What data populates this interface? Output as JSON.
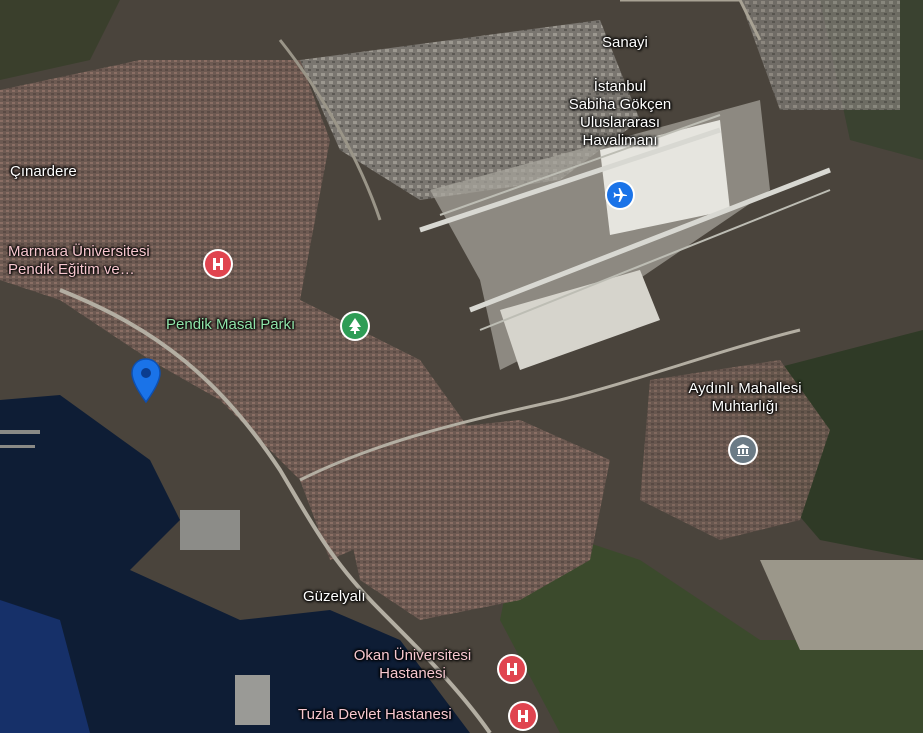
{
  "map": {
    "type": "satellite",
    "colors": {
      "sea": "#0e1d35",
      "land": "#4a443c",
      "urban": "#6a564f",
      "runway": "#cfcfc6",
      "hospital_pin": "#e0444f",
      "park_pin": "#2e9d56",
      "airport_pin": "#1a73e8",
      "office_pin": "#6b7b86",
      "location_pin": "#1a73e8"
    },
    "labels": {
      "cinardere": "Çınardere",
      "sanayi": "Sanayi",
      "airport_line1": "İstanbul",
      "airport_line2": "Sabiha Gökçen",
      "airport_line3": "Uluslararası",
      "airport_line4": "Havalimanı",
      "marmara_line1": "Marmara Üniversitesi",
      "marmara_line2": "Pendik Eğitim ve…",
      "pendik_park": "Pendik Masal Parkı",
      "aydinli_line1": "Aydınlı Mahallesi",
      "aydinli_line2": "Muhtarlığı",
      "guzelyali": "Güzelyalı",
      "okan_line1": "Okan Üniversitesi",
      "okan_line2": "Hastanesi",
      "tuzla": "Tuzla Devlet Hastanesi"
    },
    "markers": {
      "hospital_icon": "hospital-icon",
      "park_icon": "tree-icon",
      "airport_icon": "airplane-icon",
      "office_icon": "government-building-icon",
      "location_icon": "location-pin-icon"
    }
  }
}
